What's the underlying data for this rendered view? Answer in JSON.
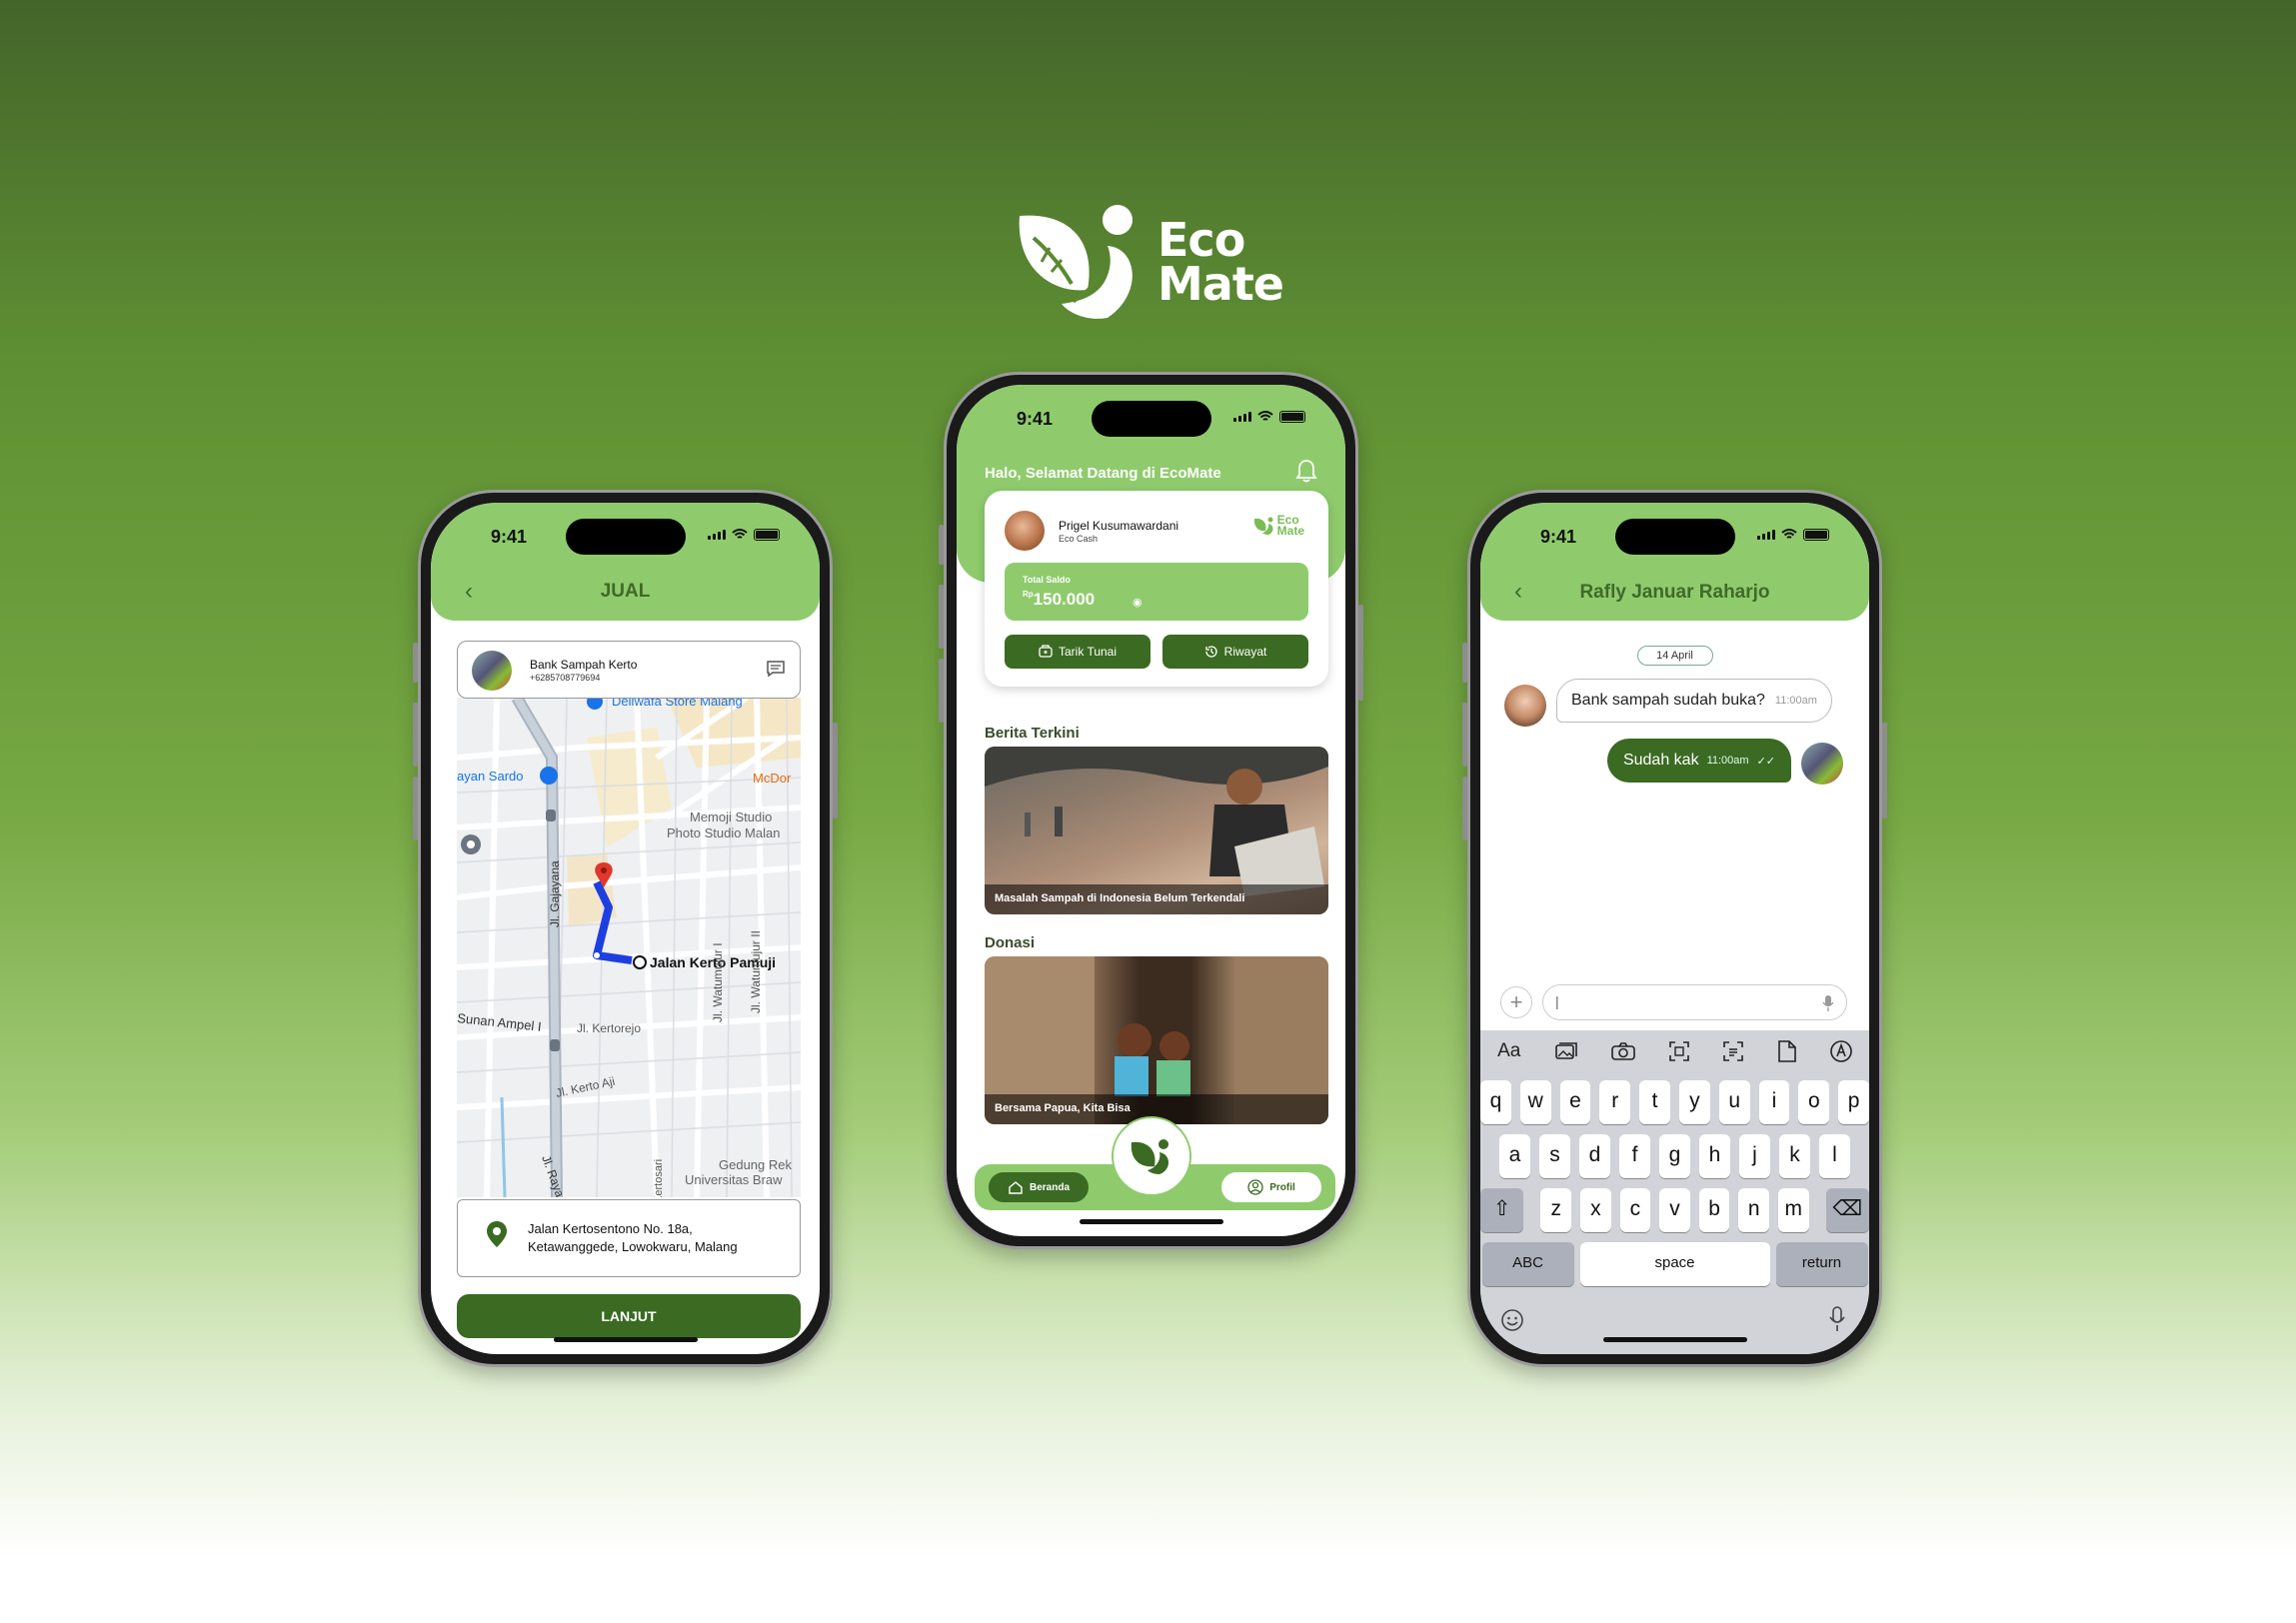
{
  "brand": {
    "name_line1": "Eco",
    "name_line2": "Mate",
    "color": "#ffffff"
  },
  "colors": {
    "primary_light": "#8fcb6c",
    "primary_dark": "#3b6a22"
  },
  "status_bar": {
    "time": "9:41"
  },
  "left_phone": {
    "title": "JUAL",
    "bank": {
      "name": "Bank Sampah Kerto",
      "phone": "+6285708779694"
    },
    "map_labels": {
      "store": "Deliwafa Store Malang",
      "sardo": "ayan Sardo",
      "mcd": "McDor",
      "studio1": "Memoji Studio",
      "studio2": "Photo Studio Malan",
      "street_main": "Jl. Gajayana",
      "destination": "Jalan Kerto Pamuji",
      "sunan": "Sunan Ampel I",
      "kertorejo": "Jl. Kertorejo",
      "watumujur1": "Jl. Watumujur I",
      "watumujur2": "Jl. Watumujur II",
      "kertoaji": "Jl. Kerto Aji",
      "kertosari": "Jl. Kertosari",
      "gedung1": "Gedung Rek",
      "gedung2": "Universitas Braw",
      "raya": "Jl. Raya"
    },
    "address_line1": "Jalan Kertosentono No. 18a,",
    "address_line2": "Ketawanggede, Lowokwaru, Malang",
    "button": "LANJUT"
  },
  "center_phone": {
    "greeting": "Halo, Selamat Datang di EcoMate",
    "user_name": "Prigel Kusumawardani",
    "wallet_label": "Eco Cash",
    "logo_line1": "Eco",
    "logo_line2": "Mate",
    "balance_label": "Total Saldo",
    "currency": "Rp",
    "balance": "150.000",
    "btn_withdraw": "Tarik Tunai",
    "btn_history": "Riwayat",
    "section_news": "Berita Terkini",
    "news_caption": "Masalah Sampah di Indonesia Belum Terkendali",
    "section_donation": "Donasi",
    "donation_caption": "Bersama Papua, Kita Bisa",
    "nav_home": "Beranda",
    "nav_profile": "Profil"
  },
  "right_phone": {
    "contact": "Rafly Januar Raharjo",
    "date": "14 April",
    "msg_in": {
      "text": "Bank sampah sudah buka?",
      "time": "11:00am"
    },
    "msg_out": {
      "text": "Sudah kak",
      "time": "11:00am"
    },
    "input_placeholder": "|",
    "kb_tool_text": "Aa",
    "kb_row1": [
      "q",
      "w",
      "e",
      "r",
      "t",
      "y",
      "u",
      "i",
      "o",
      "p"
    ],
    "kb_row2": [
      "a",
      "s",
      "d",
      "f",
      "g",
      "h",
      "j",
      "k",
      "l"
    ],
    "kb_row3": [
      "z",
      "x",
      "c",
      "v",
      "b",
      "n",
      "m"
    ],
    "kb_abc": "ABC",
    "kb_space": "space",
    "kb_return": "return"
  }
}
